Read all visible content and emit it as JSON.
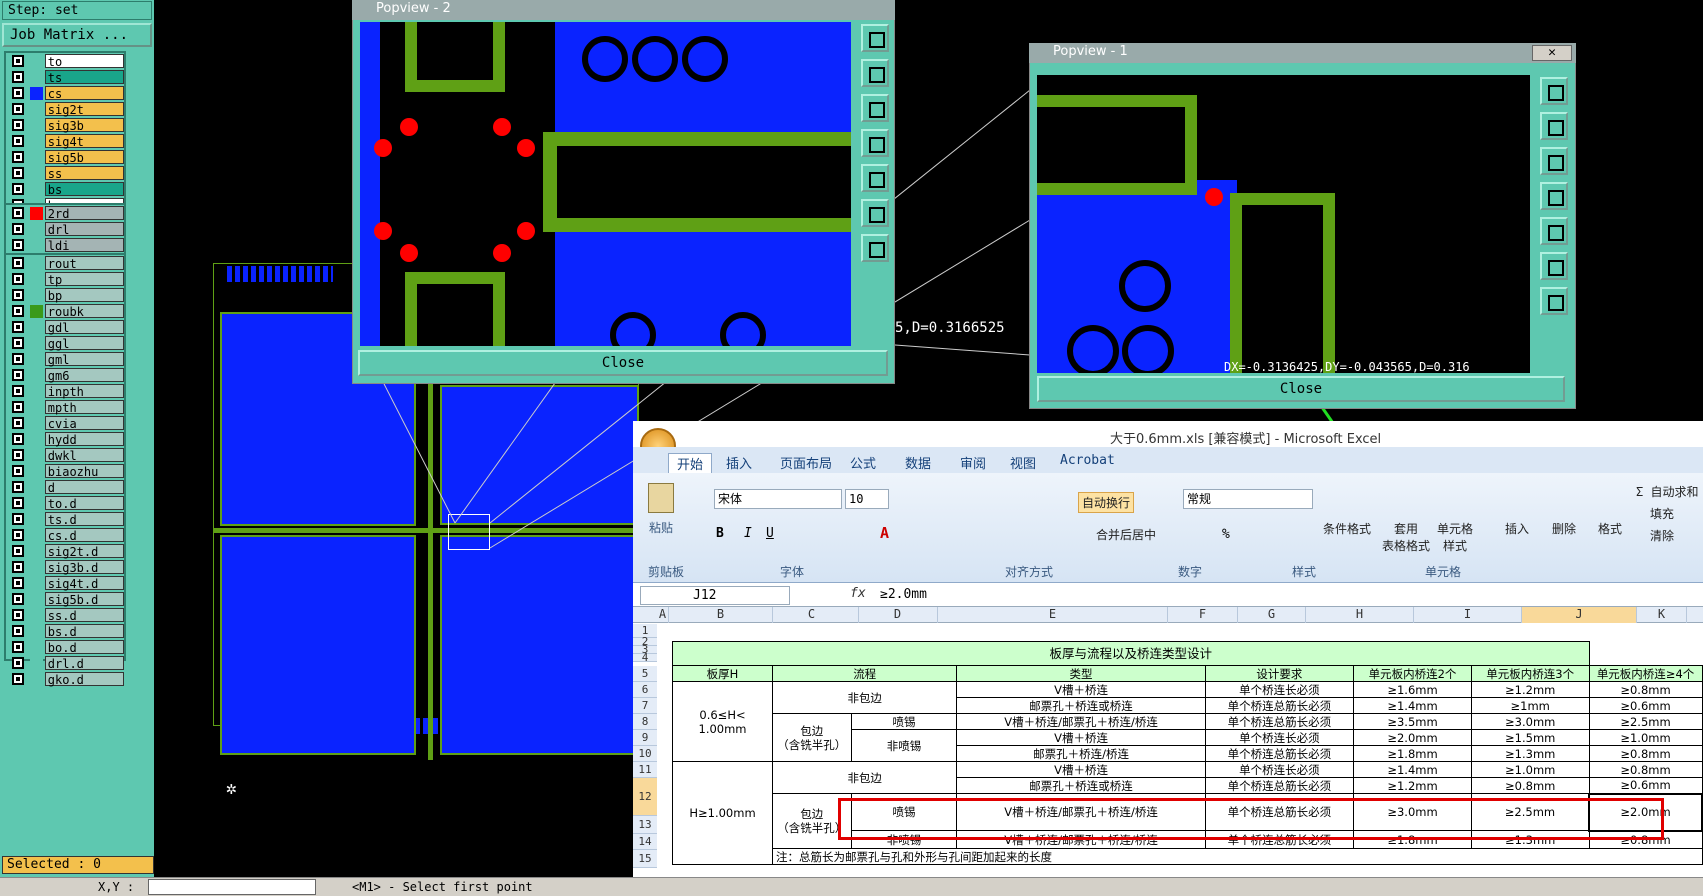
{
  "left_panel": {
    "step": "Step: set",
    "job_matrix": "Job Matrix ...",
    "group1": [
      {
        "name": "to",
        "color": "#ffffff",
        "swatch": "#5ec8b0"
      },
      {
        "name": "ts",
        "color": "#19a58a",
        "swatch": "#5ec8b0"
      },
      {
        "name": "cs",
        "color": "#f3c04c",
        "swatch": "#0a23ff"
      },
      {
        "name": "sig2t",
        "color": "#f3c04c",
        "swatch": "#5ec8b0"
      },
      {
        "name": "sig3b",
        "color": "#f3c04c",
        "swatch": "#5ec8b0"
      },
      {
        "name": "sig4t",
        "color": "#f3c04c",
        "swatch": "#5ec8b0"
      },
      {
        "name": "sig5b",
        "color": "#f3c04c",
        "swatch": "#5ec8b0"
      },
      {
        "name": "ss",
        "color": "#f3c04c",
        "swatch": "#5ec8b0"
      },
      {
        "name": "bs",
        "color": "#19a58a",
        "swatch": "#5ec8b0"
      },
      {
        "name": "bo",
        "color": "#ffffff",
        "swatch": "#5ec8b0"
      }
    ],
    "group2": [
      {
        "name": "2rd",
        "color": "#a4b4b4",
        "swatch": "#ff0000"
      },
      {
        "name": "drl",
        "color": "#a4b4b4",
        "swatch": "#5ec8b0"
      },
      {
        "name": "ldi",
        "color": "#a4b4b4",
        "swatch": "#5ec8b0"
      }
    ],
    "group3": [
      "rout",
      "tp",
      "bp",
      "roubk",
      "gdl",
      "ggl",
      "gml",
      "gm6",
      "inpth",
      "mpth",
      "cvia",
      "hydd",
      "dwkl",
      "biaozhu",
      "d",
      "to.d",
      "ts.d",
      "cs.d",
      "sig2t.d",
      "sig3b.d",
      "sig4t.d",
      "sig5b.d",
      "ss.d",
      "bs.d",
      "bo.d",
      "drl.d",
      "gko.d"
    ],
    "selected": "Selected : 0"
  },
  "canvas": {
    "measure_text": "5,D=0.3166525"
  },
  "popview2": {
    "title": "Popview - 2",
    "close": "Close"
  },
  "popview1": {
    "title": "Popview - 1",
    "close": "Close",
    "readout": "DX=-0.3136425,DY=-0.043565,D=0.316"
  },
  "bottom": {
    "xy": "X,Y :",
    "prompt": "<M1> - Select first point"
  },
  "excel": {
    "title": "大于0.6mm.xls  [兼容模式] - Microsoft Excel",
    "tabs": [
      "开始",
      "插入",
      "页面布局",
      "公式",
      "数据",
      "审阅",
      "视图",
      "Acrobat"
    ],
    "groups": [
      "剪贴板",
      "字体",
      "对齐方式",
      "数字",
      "样式",
      "单元格"
    ],
    "paste": "粘贴",
    "font": "宋体",
    "size": "10",
    "wrap": "自动换行",
    "merge": "合并后居中",
    "numfmt": "常规",
    "styles": [
      "条件格式",
      "套用\n表格格式",
      "单元格\n样式"
    ],
    "cells": [
      "插入",
      "删除",
      "格式"
    ],
    "edit": [
      "Σ 自动求和",
      "填充",
      "清除"
    ],
    "namebox": "J12",
    "formula": "≥2.0mm",
    "columns": [
      "A",
      "B",
      "C",
      "D",
      "E",
      "F",
      "G",
      "H",
      "I",
      "J",
      "K"
    ],
    "rows": [
      "1",
      "2",
      "3",
      "4",
      "5",
      "6",
      "7",
      "8",
      "9",
      "10",
      "11",
      "12",
      "13",
      "14",
      "15"
    ],
    "table_title": "板厚与流程以及桥连类型设计",
    "headers": [
      "板厚H",
      "流程",
      "类型",
      "设计要求",
      "单元板内桥连2个",
      "单元板内桥连3个",
      "单元板内桥连≥4个"
    ],
    "r5": [
      "V槽＋桥连",
      "单个桥连长必须",
      "≥1.6mm",
      "≥1.2mm",
      "≥0.8mm"
    ],
    "r6": [
      "邮票孔＋桥连或桥连",
      "单个桥连总筋长必须",
      "≥1.4mm",
      "≥1mm",
      "≥0.6mm"
    ],
    "r7": [
      "V槽＋桥连/邮票孔＋桥连/桥连",
      "单个桥连总筋长必须",
      "≥3.5mm",
      "≥3.0mm",
      "≥2.5mm"
    ],
    "r8": [
      "V槽＋桥连",
      "单个桥连长必须",
      "≥2.0mm",
      "≥1.5mm",
      "≥1.0mm"
    ],
    "r9": [
      "邮票孔＋桥连/桥连",
      "单个桥连总筋长必须",
      "≥1.8mm",
      "≥1.3mm",
      "≥0.8mm"
    ],
    "r10": [
      "V槽＋桥连",
      "单个桥连长必须",
      "≥1.4mm",
      "≥1.0mm",
      "≥0.8mm"
    ],
    "r11": [
      "邮票孔＋桥连或桥连",
      "单个桥连总筋长必须",
      "≥1.2mm",
      "≥0.8mm",
      "≥0.6mm"
    ],
    "r12": [
      "V槽＋桥连/邮票孔＋桥连/桥连",
      "单个桥连总筋长必须",
      "≥3.0mm",
      "≥2.5mm",
      "≥2.0mm"
    ],
    "r13": [
      "V槽＋桥连/邮票孔＋桥连/桥连",
      "单个桥连总筋长必须",
      "≥1.8mm",
      "≥1.3mm",
      "≥0.8mm"
    ],
    "b1": "0.6≤H<\n1.00mm",
    "b2": "H≥1.00mm",
    "fei": "非包边",
    "bao": "包边\n（含铣半孔）",
    "pen": "喷锡",
    "fpen": "非喷锡",
    "note": "注：总筋长为邮票孔与孔和外形与孔间距加起来的长度"
  }
}
